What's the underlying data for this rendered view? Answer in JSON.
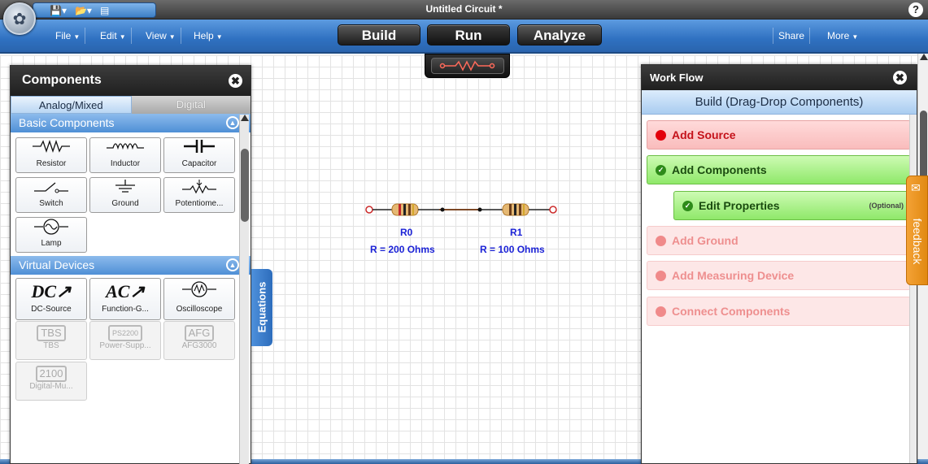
{
  "window": {
    "title": "Untitled Circuit *",
    "help": "?"
  },
  "menus": [
    {
      "label": "File"
    },
    {
      "label": "Edit"
    },
    {
      "label": "View"
    },
    {
      "label": "Help"
    }
  ],
  "right_menus": {
    "share": "Share",
    "more": "More"
  },
  "modes": {
    "build": "Build",
    "run": "Run",
    "analyze": "Analyze"
  },
  "components_panel": {
    "title": "Components",
    "tabs": {
      "analog": "Analog/Mixed",
      "digital": "Digital"
    },
    "basic": {
      "title": "Basic Components",
      "items": [
        {
          "label": "Resistor",
          "icon": "resistor-icon"
        },
        {
          "label": "Inductor",
          "icon": "inductor-icon"
        },
        {
          "label": "Capacitor",
          "icon": "capacitor-icon"
        },
        {
          "label": "Switch",
          "icon": "switch-icon"
        },
        {
          "label": "Ground",
          "icon": "ground-icon"
        },
        {
          "label": "Potentiome...",
          "icon": "potentiometer-icon"
        },
        {
          "label": "Lamp",
          "icon": "lamp-icon"
        }
      ]
    },
    "virtual": {
      "title": "Virtual Devices",
      "items": [
        {
          "label": "DC-Source",
          "icon": "dc-source-icon"
        },
        {
          "label": "Function-G...",
          "icon": "function-generator-icon"
        },
        {
          "label": "Oscilloscope",
          "icon": "oscilloscope-icon"
        },
        {
          "label": "TBS",
          "badge": "TBS",
          "disabled": true
        },
        {
          "label": "Power-Supp...",
          "badge": "PS2200",
          "disabled": true
        },
        {
          "label": "AFG3000",
          "badge": "AFG",
          "disabled": true
        },
        {
          "label": "Digital-Mu...",
          "badge": "2100",
          "disabled": true
        }
      ]
    }
  },
  "equations_tab": "Equations",
  "circuit": {
    "r0": {
      "name": "R0",
      "value": "R = 200 Ohms"
    },
    "r1": {
      "name": "R1",
      "value": "R = 100 Ohms"
    }
  },
  "workflow": {
    "title": "Work Flow",
    "subtitle": "Build (Drag-Drop Components)",
    "steps": [
      {
        "label": "Add Source",
        "state": "active-red"
      },
      {
        "label": "Add Components",
        "state": "done"
      },
      {
        "label": "Edit Properties",
        "state": "done",
        "note": "(Optional)"
      },
      {
        "label": "Add Ground",
        "state": "pending"
      },
      {
        "label": "Add Measuring Device",
        "state": "pending"
      },
      {
        "label": "Connect Components",
        "state": "pending"
      }
    ]
  },
  "feedback_tab": "feedback",
  "colors": {
    "accent_blue": "#2f71c1",
    "label_blue": "#1b22d6",
    "workflow_red": "#c4121a",
    "workflow_green": "#8fe86a",
    "feedback_orange": "#e18911"
  }
}
